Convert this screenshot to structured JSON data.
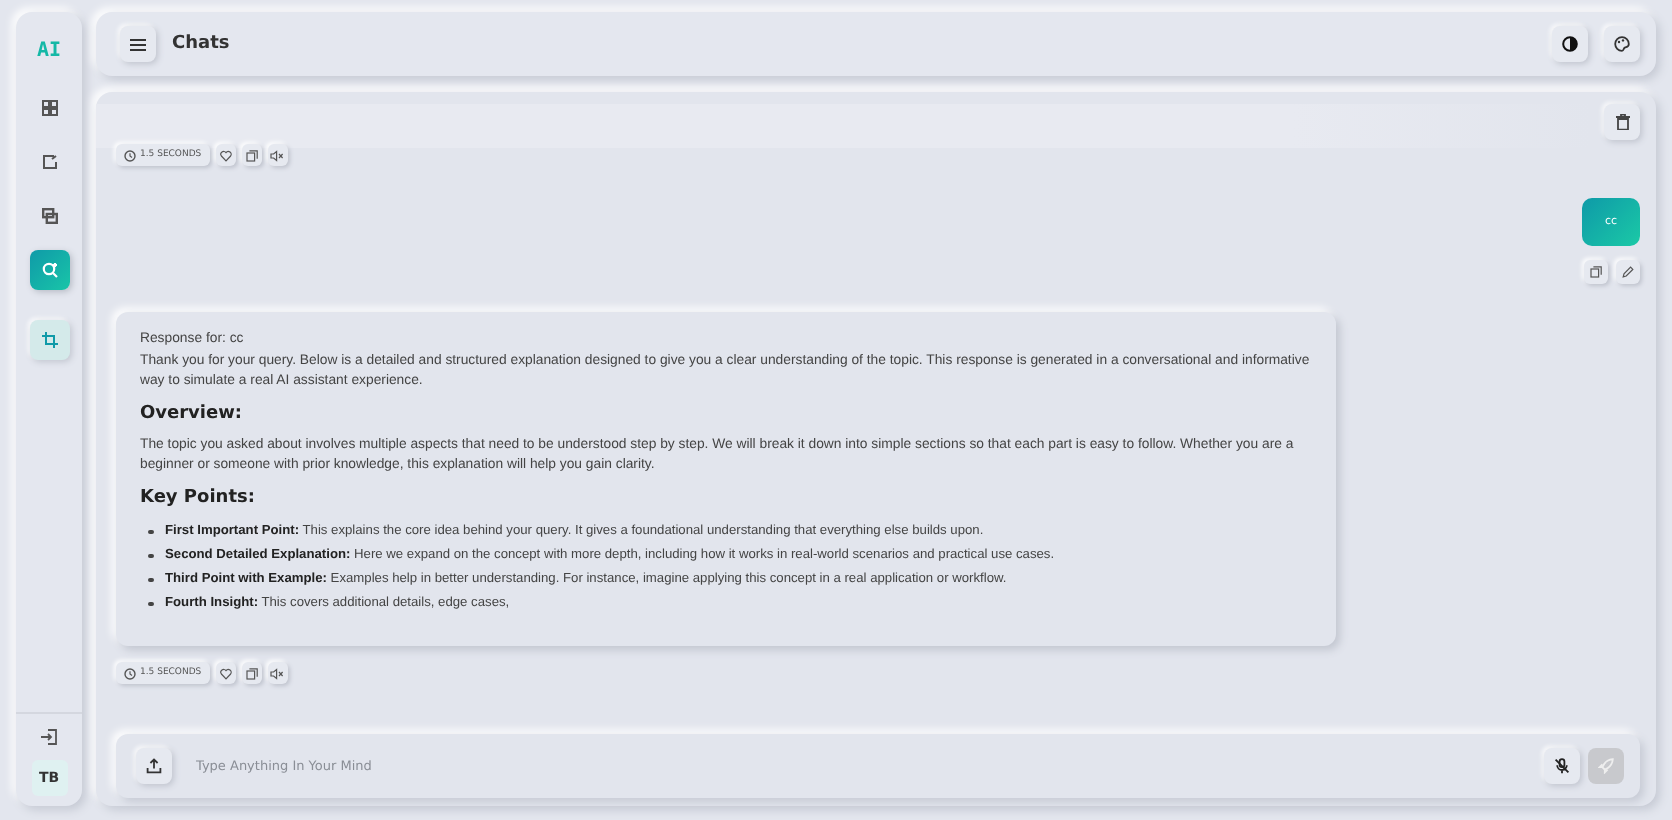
{
  "sidebar": {
    "logo": "AI",
    "items": [
      {
        "kind": "nav",
        "selected": false
      },
      {
        "kind": "nav",
        "selected": false
      },
      {
        "kind": "nav",
        "selected": false
      },
      {
        "kind": "nav",
        "selected": true
      },
      {
        "kind": "action",
        "selected": false
      }
    ],
    "avatar": "TB"
  },
  "header": {
    "title": "Chats"
  },
  "messages": [
    {
      "kind": "meta",
      "time": "1.5 SECONDS"
    },
    {
      "kind": "user",
      "text": "cc"
    },
    {
      "kind": "assistant",
      "time": "1.5 SECONDS",
      "blocks": [
        {
          "kind": "text",
          "text": "Response for: cc"
        },
        {
          "kind": "text",
          "text": "Thank you for your query. Below is a detailed and structured explanation designed to give you a clear understanding of the topic. This response is generated in a conversational and informative way to simulate a real AI assistant experience."
        },
        {
          "kind": "heading",
          "text": "Overview:"
        },
        {
          "kind": "text",
          "text": "The topic you asked about involves multiple aspects that need to be understood step by step. We will break it down into simple sections so that each part is easy to follow. Whether you are a beginner or someone with prior knowledge, this explanation will help you gain clarity."
        },
        {
          "kind": "heading",
          "text": "Key Points:"
        },
        {
          "kind": "list",
          "items": [
            "**First Important Point:** This explains the core idea behind your query. It gives a foundational understanding that everything else builds upon.",
            "**Second Detailed Explanation:** Here we expand on the concept with more depth, including how it works in real-world scenarios and practical use cases.",
            "**Third Point with Example:** Examples help in better understanding. For instance, imagine applying this concept in a real application or workflow.",
            "**Fourth Insight:** This covers additional details, edge cases,"
          ]
        }
      ]
    }
  ],
  "composer": {
    "placeholder": "Type Anything In Your Mind",
    "send_disabled": true
  }
}
